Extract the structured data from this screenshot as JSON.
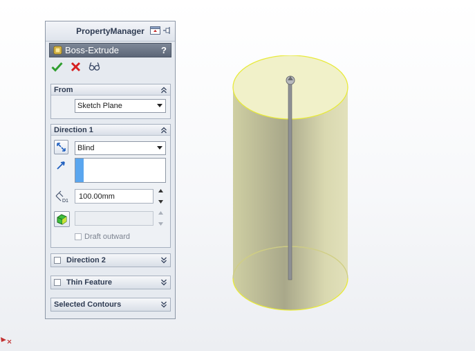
{
  "property_manager": {
    "title": "PropertyManager",
    "feature": {
      "name": "Boss-Extrude",
      "help": "?"
    },
    "actions": [
      "ok-icon",
      "cancel-icon",
      "preview-icon"
    ],
    "from": {
      "title": "From",
      "start_condition": "Sketch Plane"
    },
    "direction1": {
      "title": "Direction 1",
      "end_condition": "Blind",
      "depth": "100.00mm",
      "draft_angle": "",
      "draft_outward_label": "Draft outward"
    },
    "direction2": {
      "title": "Direction 2",
      "checked": false
    },
    "thin_feature": {
      "title": "Thin Feature",
      "checked": false
    },
    "selected_contours": {
      "title": "Selected Contours"
    }
  },
  "colors": {
    "accent": "#5aa6ef",
    "ok_green": "#2f9e2f",
    "cancel_red": "#d62020",
    "model_fill": "#d7d6a7",
    "model_edge": "#e8ea3a"
  }
}
